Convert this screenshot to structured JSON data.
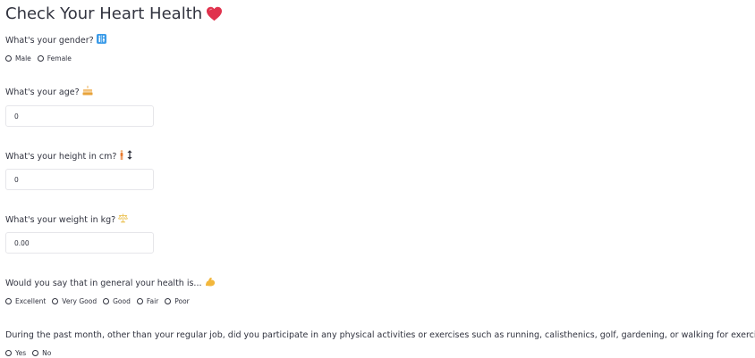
{
  "title": "Check Your Heart Health",
  "questions": {
    "gender": {
      "label": "What's your gender?",
      "options": [
        "Male",
        "Female"
      ]
    },
    "age": {
      "label": "What's your age?",
      "value": "0"
    },
    "height": {
      "label": "What's your height in cm?",
      "value": "0"
    },
    "weight": {
      "label": "What's your weight in kg?",
      "value": "0.00"
    },
    "health": {
      "label": "Would you say that in general your health is...",
      "options": [
        "Excellent",
        "Very Good",
        "Good",
        "Fair",
        "Poor"
      ]
    },
    "activity": {
      "label": "During the past month, other than your regular job, did you participate in any physical activities or exercises such as running, calisthenics, golf, gardening, or walking for exercise?",
      "options": [
        "Yes",
        "No"
      ]
    }
  },
  "icons": {
    "title": "heart-icon",
    "gender": "restroom-icon",
    "age": "birthday-cake-icon",
    "height": "person-standing-icon",
    "weight": "scale-icon",
    "health": "flexed-biceps-icon",
    "activity": "person-running-icon"
  },
  "colors": {
    "text": "#31333f",
    "heart": "#e0324d",
    "input_border": "#e6e6ea"
  }
}
